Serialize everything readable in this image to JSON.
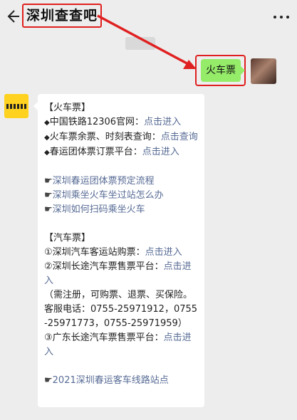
{
  "header": {
    "title": "深圳查查吧"
  },
  "chat": {
    "time_label": "",
    "sent_message": "火车票",
    "reply": {
      "train_heading": "【火车票】",
      "bullet_char": "◆",
      "pointer_char": "☛",
      "train_items": [
        {
          "prefix": "中国铁路12306官网：",
          "link": "点击进入"
        },
        {
          "prefix": "火车票余票、时刻表查询：",
          "link": "点击查询"
        },
        {
          "prefix": "春运团体票订票平台：",
          "link": "点击进入"
        }
      ],
      "train_links": [
        "深圳春运团体票预定流程",
        "深圳乘坐火车坐过站怎么办",
        "深圳如何扫码乘坐火车"
      ],
      "bus_heading": "【汽车票】",
      "bus_items": [
        {
          "prefix": "①深圳汽车客运站购票：",
          "link": "点击进入"
        },
        {
          "prefix": "②深圳长途汽车票售票平台：",
          "link": "点击进入"
        }
      ],
      "bus_note": "（需注册，可购票、退票、买保险。客服电话：0755-25971912，0755-25971773，0755-25971959）",
      "bus_item_3": {
        "prefix": "③广东长途汽车票售票平台：",
        "link": "点击进入"
      },
      "bottom_link": "2021深圳春运客车线路站点"
    }
  },
  "colors": {
    "background": "#ededed",
    "sent_bubble": "#95ec69",
    "link": "#576b95",
    "highlight": "#e02020",
    "bot_avatar": "#ffd21f"
  },
  "icons": {
    "back": "back-arrow-icon",
    "more": "more-dots-icon"
  }
}
